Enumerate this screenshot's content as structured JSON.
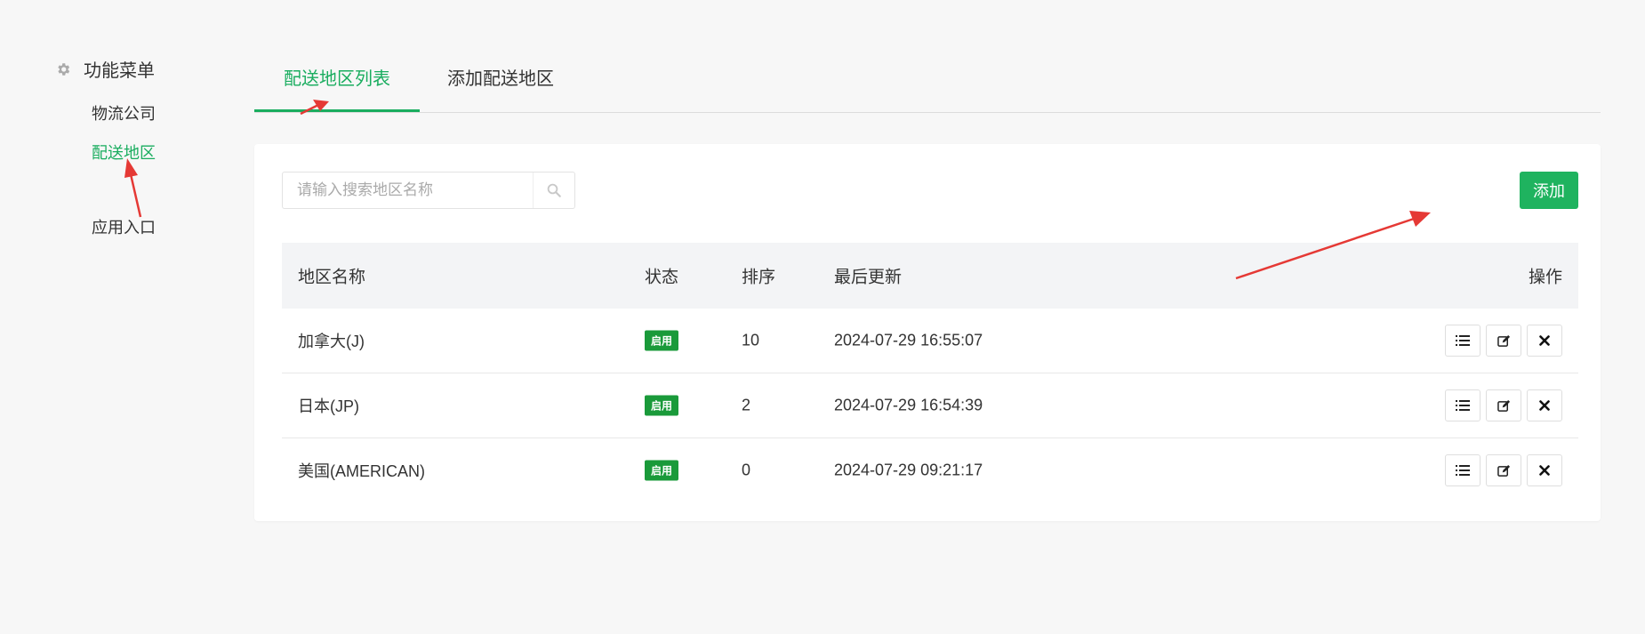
{
  "sidebar": {
    "title": "功能菜单",
    "items": [
      {
        "label": "物流公司",
        "active": false
      },
      {
        "label": "配送地区",
        "active": true
      },
      {
        "label": "应用入口",
        "active": false
      }
    ]
  },
  "tabs": [
    {
      "label": "配送地区列表",
      "active": true
    },
    {
      "label": "添加配送地区",
      "active": false
    }
  ],
  "search": {
    "placeholder": "请输入搜索地区名称",
    "value": ""
  },
  "toolbar": {
    "add_label": "添加"
  },
  "table": {
    "headers": {
      "name": "地区名称",
      "status": "状态",
      "order": "排序",
      "updated": "最后更新",
      "ops": "操作"
    },
    "rows": [
      {
        "name": "加拿大(J)",
        "status": "启用",
        "order": "10",
        "updated": "2024-07-29 16:55:07"
      },
      {
        "name": "日本(JP)",
        "status": "启用",
        "order": "2",
        "updated": "2024-07-29 16:54:39"
      },
      {
        "name": "美国(AMERICAN)",
        "status": "启用",
        "order": "0",
        "updated": "2024-07-29 09:21:17"
      }
    ]
  },
  "colors": {
    "accent": "#1aad5f",
    "badge": "#1a9a3a",
    "annotation": "#e53935"
  }
}
